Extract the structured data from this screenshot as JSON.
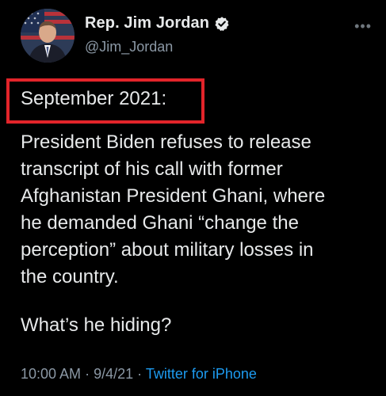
{
  "author": {
    "display_name": "Rep. Jim Jordan",
    "handle": "@Jim_Jordan",
    "verified": true,
    "avatar_icon": "profile-photo"
  },
  "tweet": {
    "highlighted_label": "September 2021:",
    "body_lines": [
      "President Biden refuses to release",
      "transcript of his call with former",
      "Afghanistan President Ghani, where",
      "he demanded Ghani “change the",
      "perception” about military losses in",
      "the country."
    ],
    "question": "What’s he hiding?"
  },
  "meta": {
    "time": "10:00 AM",
    "separator_1": "·",
    "date": "9/4/21",
    "separator_2": "·",
    "source": "Twitter for iPhone"
  },
  "colors": {
    "background": "#000000",
    "text": "#e7e9ea",
    "muted": "#8b98a5",
    "link": "#1d9bf0",
    "highlight_box": "#e2242a"
  },
  "icons": {
    "verified": "verified-badge-icon",
    "more": "more-options-icon"
  }
}
